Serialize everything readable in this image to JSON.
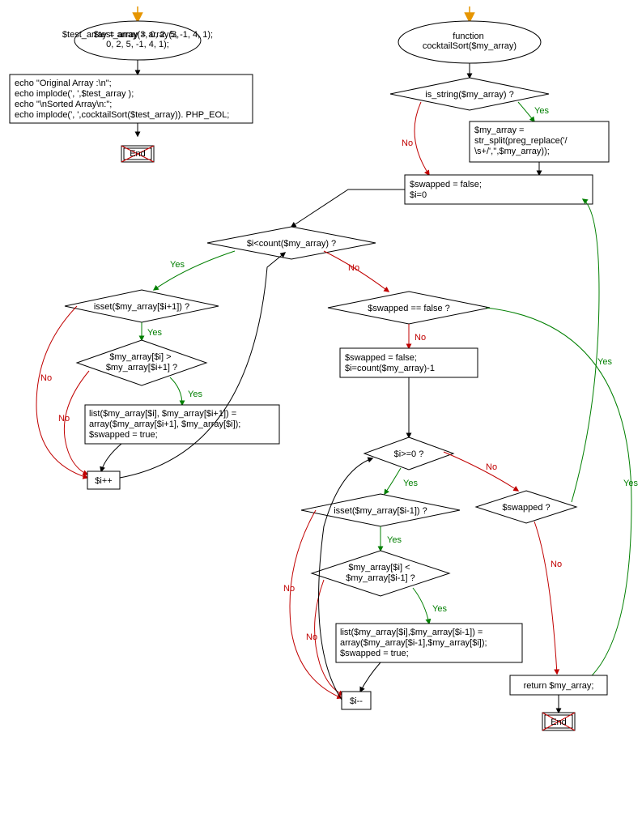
{
  "diagram_kind": "flowchart",
  "left_flow": {
    "start": "$test_array = array(3, 0, 2, 5, -1, 4, 1);",
    "process_lines": [
      "echo \"Original Array :\\n\";",
      "echo implode(', ',$test_array );",
      "echo \"\\nSorted Array\\n:\";",
      "echo implode(', ',cocktailSort($test_array)). PHP_EOL;"
    ],
    "end": "End"
  },
  "right_flow": {
    "func": "function cocktailSort($my_array)",
    "dec_is_string": "is_string($my_array) ?",
    "proc_str_split_lines": [
      "$my_array =",
      "str_split(preg_replace('/",
      "\\s+/','',$my_array));"
    ],
    "proc_init_lines": [
      "$swapped = false;",
      "$i=0"
    ],
    "dec_fwd_loop": "$i<count($my_array) ?",
    "dec_isset_next": "isset($my_array[$i+1]) ?",
    "dec_gt_lines": [
      "$my_array[$i] >",
      "$my_array[$i+1] ?"
    ],
    "proc_swap_fwd_lines": [
      "list($my_array[$i], $my_array[$i+1]) =",
      "array($my_array[$i+1], $my_array[$i]);",
      "$swapped = true;"
    ],
    "proc_inc": "$i++",
    "dec_swapped_false": "$swapped == false ?",
    "proc_reset_lines": [
      "$swapped = false;",
      "$i=count($my_array)-1"
    ],
    "dec_bwd_loop": "$i>=0 ?",
    "dec_isset_prev": "isset($my_array[$i-1]) ?",
    "dec_lt_lines": [
      "$my_array[$i] <",
      "$my_array[$i-1] ?"
    ],
    "proc_swap_bwd_lines": [
      "list($my_array[$i],$my_array[$i-1]) =",
      "array($my_array[$i-1],$my_array[$i]);",
      "$swapped = true;"
    ],
    "proc_dec": "$i--",
    "dec_swapped": "$swapped ?",
    "proc_return": "return $my_array;",
    "end2": "End"
  },
  "labels": {
    "yes": "Yes",
    "no": "No"
  }
}
